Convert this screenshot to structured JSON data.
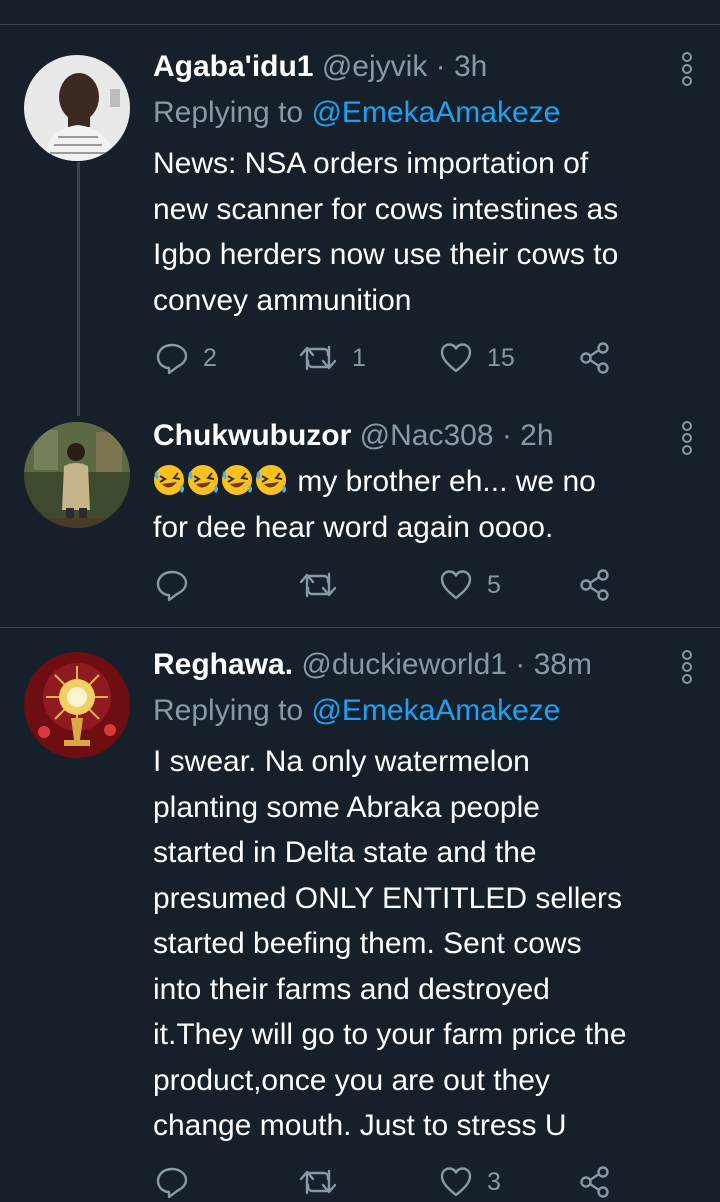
{
  "tweets": [
    {
      "name": "Agaba'idu1",
      "handle": "@ejyvik",
      "time": "· 3h",
      "replying_prefix": "Replying to ",
      "replying_to": "@EmekaAmakeze",
      "lines": [
        "News: NSA orders importation of",
        "new scanner for cows intestines as",
        "Igbo herders now use their cows to",
        "convey ammunition"
      ],
      "replies": "2",
      "retweets": "1",
      "likes": "15"
    },
    {
      "name": "Chukwubuzor",
      "handle": "@Nac308",
      "time": "· 2h",
      "emoji": [
        "rolling-on-floor-laughing",
        "rolling-on-floor-laughing",
        "rolling-on-floor-laughing",
        "rolling-on-floor-laughing"
      ],
      "line1_text": " my brother eh... we no",
      "line2_text": "for dee hear word again oooo.",
      "replies": "",
      "retweets": "",
      "likes": "5"
    },
    {
      "name": "Reghawa.",
      "handle": "@duckieworld1",
      "time": "· 38m",
      "replying_prefix": "Replying to ",
      "replying_to": "@EmekaAmakeze",
      "lines": [
        "I swear. Na only watermelon",
        "planting some Abraka people",
        "started in Delta state and the",
        "presumed ONLY ENTITLED sellers",
        "started beefing them. Sent cows",
        "into their farms and destroyed",
        "it.They will go to your farm price the",
        "product,once you are out they",
        "change mouth. Just to stress U"
      ],
      "replies": "",
      "retweets": "",
      "likes": "3"
    }
  ],
  "colors": {
    "background": "#15202b",
    "divider": "#38444d",
    "secondary_text": "#8899a6",
    "link": "#1da1f2"
  },
  "icons": [
    "reply-icon",
    "retweet-icon",
    "like-icon",
    "share-icon",
    "more-icon",
    "avatar"
  ]
}
